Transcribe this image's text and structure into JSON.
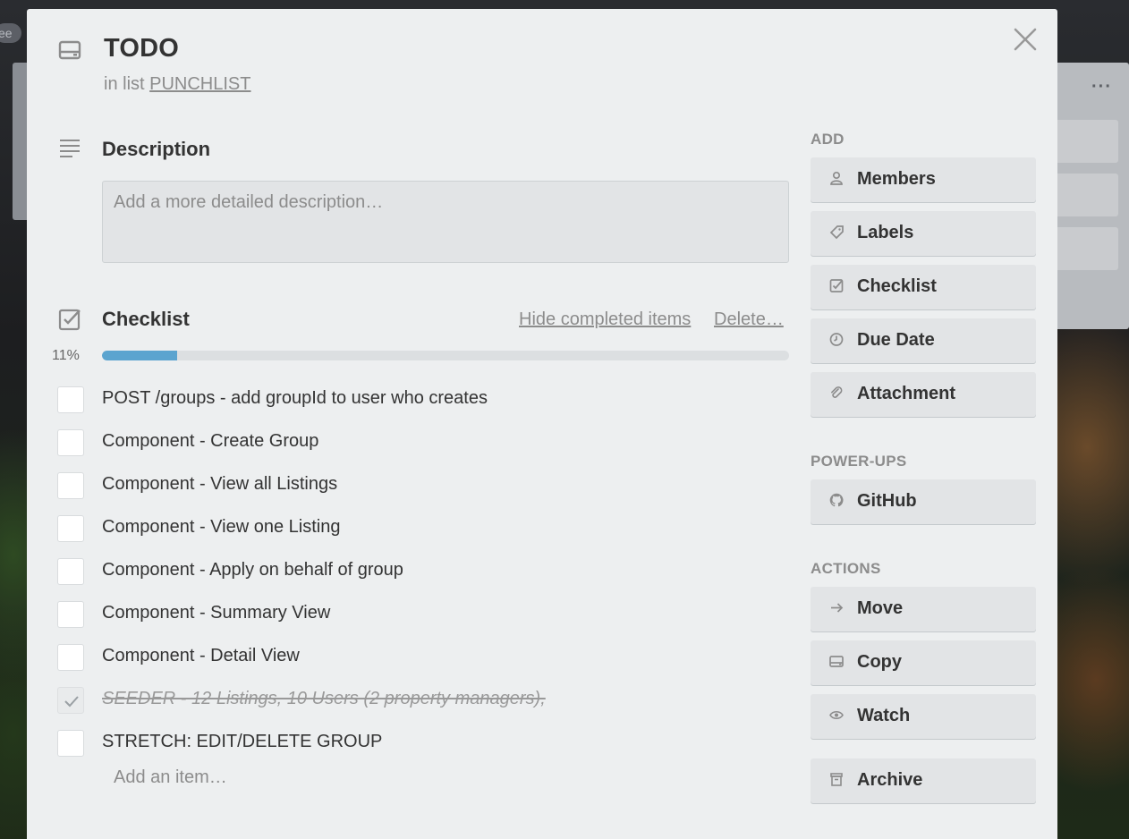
{
  "background": {
    "pill_text": "ee"
  },
  "card": {
    "title": "TODO",
    "list_prefix": "in list",
    "list_name": "PUNCHLIST"
  },
  "description": {
    "heading": "Description",
    "placeholder": "Add a more detailed description…"
  },
  "checklist": {
    "heading": "Checklist",
    "hide_completed_label": "Hide completed items",
    "delete_label": "Delete…",
    "progress_percent_label": "11%",
    "progress_value": 0.11,
    "progress_color": "#5ba4cf",
    "items": [
      {
        "text": "POST /groups - add groupId to user who creates",
        "checked": false
      },
      {
        "text": "Component - Create Group",
        "checked": false
      },
      {
        "text": "Component - View all Listings",
        "checked": false
      },
      {
        "text": "Component - View one Listing",
        "checked": false
      },
      {
        "text": "Component - Apply on behalf of group",
        "checked": false
      },
      {
        "text": "Component - Summary View",
        "checked": false
      },
      {
        "text": "Component - Detail View",
        "checked": false
      },
      {
        "text": "SEEDER - 12 Listings, 10 Users (2 property managers),",
        "checked": true
      },
      {
        "text": "STRETCH: EDIT/DELETE GROUP",
        "checked": false
      }
    ],
    "add_item_placeholder": "Add an item…"
  },
  "sidebar": {
    "add_heading": "ADD",
    "add_buttons": [
      {
        "label": "Members",
        "icon": "person-icon"
      },
      {
        "label": "Labels",
        "icon": "tag-icon"
      },
      {
        "label": "Checklist",
        "icon": "checkbox-icon"
      },
      {
        "label": "Due Date",
        "icon": "clock-icon"
      },
      {
        "label": "Attachment",
        "icon": "paperclip-icon"
      }
    ],
    "powerups_heading": "POWER-UPS",
    "powerups_buttons": [
      {
        "label": "GitHub",
        "icon": "github-icon"
      }
    ],
    "actions_heading": "ACTIONS",
    "actions_buttons": [
      {
        "label": "Move",
        "icon": "arrow-right-icon"
      },
      {
        "label": "Copy",
        "icon": "card-icon"
      },
      {
        "label": "Watch",
        "icon": "eye-icon"
      },
      {
        "label": "Archive",
        "icon": "archive-icon"
      }
    ]
  }
}
